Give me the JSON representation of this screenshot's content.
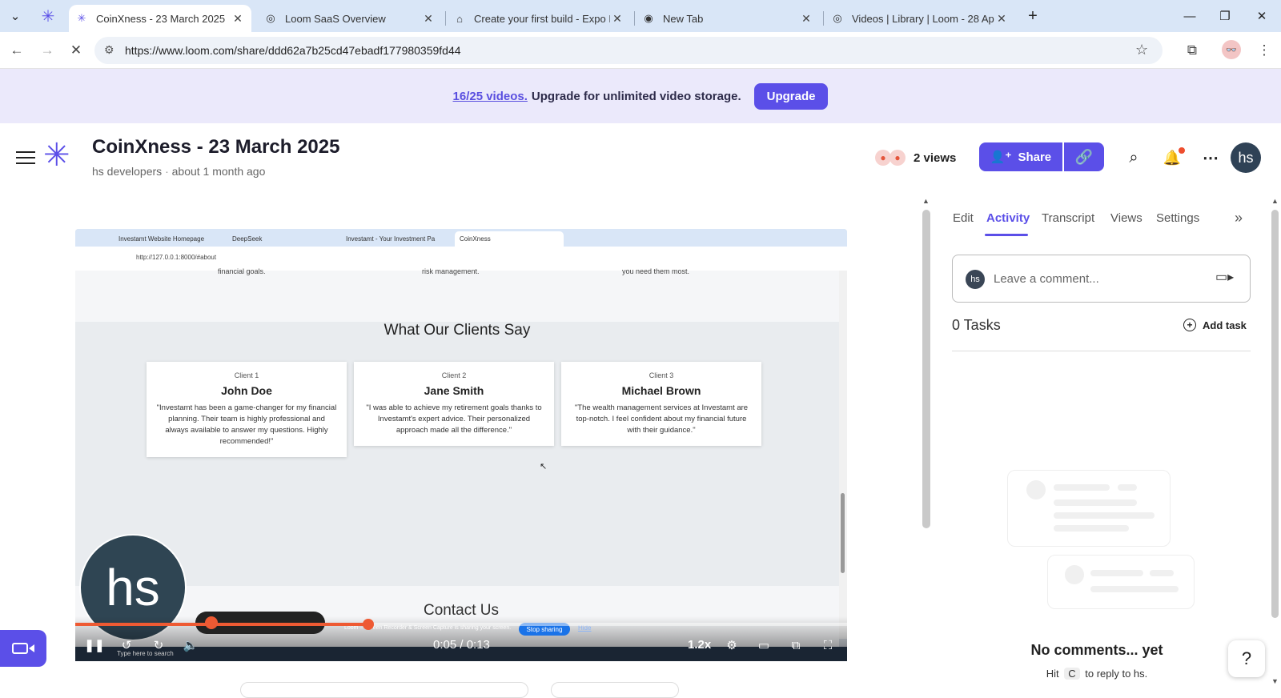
{
  "browser": {
    "tabs": [
      {
        "title": "CoinXness - 23 March 2025",
        "active": true
      },
      {
        "title": "Loom SaaS Overview",
        "active": false
      },
      {
        "title": "Create your first build - Expo Do",
        "active": false
      },
      {
        "title": "New Tab",
        "active": false
      },
      {
        "title": "Videos | Library | Loom - 28 Apr",
        "active": false
      }
    ],
    "url": "https://www.loom.com/share/ddd62a7b25cd47ebadf177980359fd44"
  },
  "banner": {
    "count": "16/25 videos.",
    "message": "Upgrade for unlimited video storage.",
    "button": "Upgrade"
  },
  "header": {
    "title": "CoinXness - 23 March 2025",
    "workspace": "hs developers",
    "time": "about 1 month ago",
    "views": "2 views",
    "share": "Share",
    "user_initials": "hs"
  },
  "video": {
    "tabs": [
      "Investamt Website Homepage",
      "DeepSeek",
      "Investamt - Your Investment Pa",
      "CoinXness"
    ],
    "url": "http://127.0.0.1:8000/#about",
    "top_snippets": [
      "financial goals.",
      "risk management.",
      "you need them most."
    ],
    "section_title": "What Our Clients Say",
    "clients": [
      {
        "image_alt": "Client 1",
        "name": "John Doe",
        "quote": "\"Investamt has been a game-changer for my financial planning. Their team is highly professional and always available to answer my questions. Highly recommended!\""
      },
      {
        "image_alt": "Client 2",
        "name": "Jane Smith",
        "quote": "\"I was able to achieve my retirement goals thanks to Investamt's expert advice. Their personalized approach made all the difference.\""
      },
      {
        "image_alt": "Client 3",
        "name": "Michael Brown",
        "quote": "\"The wealth management services at Investamt are top-notch. I feel confident about my financial future with their guidance.\""
      }
    ],
    "contact_title": "Contact Us",
    "camera_initials": "hs",
    "sharing_note": "Loom – Screen Recorder & Screen Capture is sharing your screen.",
    "stop_sharing": "Stop sharing",
    "hide": "Hide",
    "taskbar_search": "Type here to search",
    "timecode": "0:05 / 0:13",
    "speed": "1.2x",
    "progress": 0.38,
    "accent": "#ee5a33"
  },
  "panel": {
    "tabs": [
      "Edit",
      "Activity",
      "Transcript",
      "Views",
      "Settings"
    ],
    "active_tab": "Activity",
    "comment_avatar": "hs",
    "comment_placeholder": "Leave a comment...",
    "tasks": "0 Tasks",
    "add_task": "Add task",
    "empty_title": "No comments... yet",
    "hint_prefix": "Hit",
    "hint_key": "C",
    "hint_suffix": "to reply to hs."
  },
  "colors": {
    "brand": "#5b4fe8",
    "banner_bg": "#ebe9fb"
  }
}
